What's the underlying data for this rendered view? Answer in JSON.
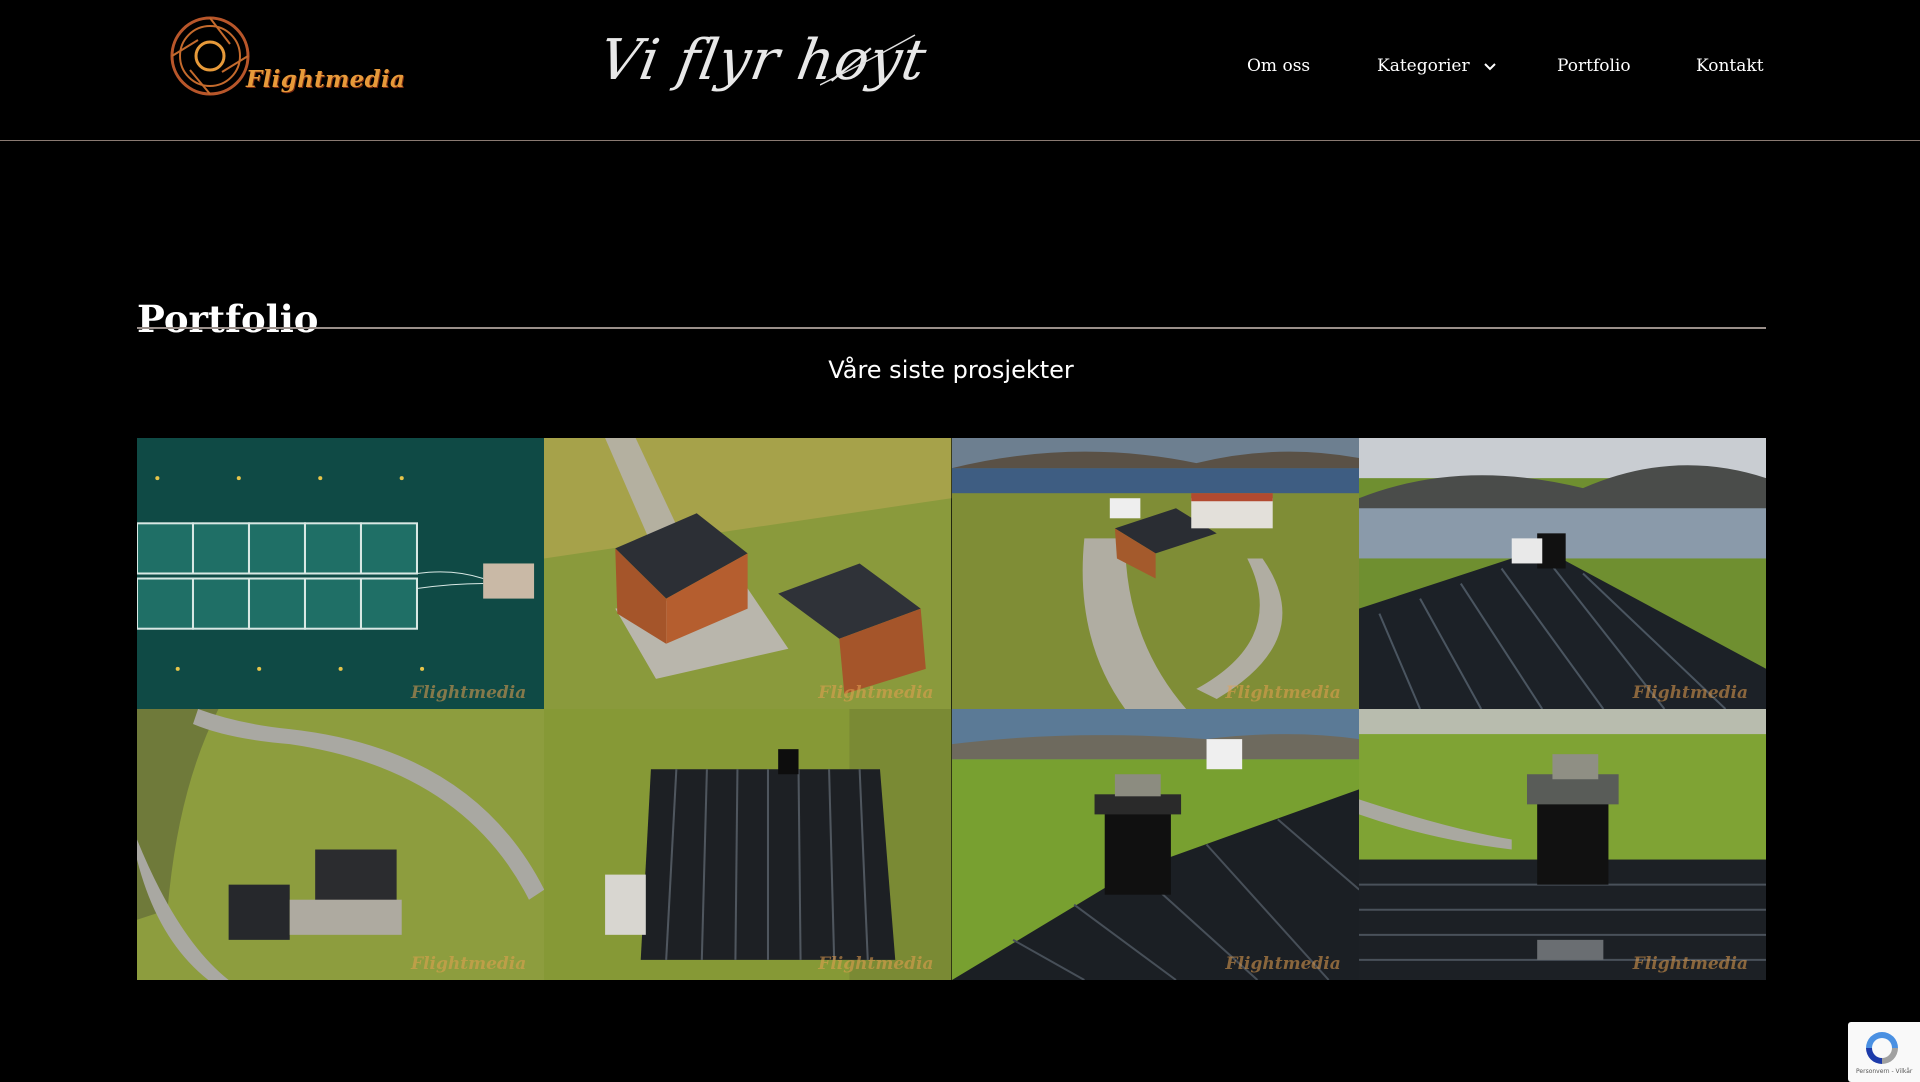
{
  "header": {
    "logo_text": "Flightmedia",
    "slogan": "Vi flyr høyt",
    "nav": [
      {
        "label": "Om oss",
        "has_dropdown": false
      },
      {
        "label": "Kategorier",
        "has_dropdown": true
      },
      {
        "label": "Portfolio",
        "has_dropdown": false
      },
      {
        "label": "Kontakt",
        "has_dropdown": false
      }
    ]
  },
  "main": {
    "title": "Portfolio",
    "subtitle": "Våre siste prosjekter",
    "watermark": "Flightmedia",
    "gallery": [
      {
        "subject": "fish-farm-aerial"
      },
      {
        "subject": "house-and-garage-aerial"
      },
      {
        "subject": "farm-by-fjord"
      },
      {
        "subject": "roof-with-fjord-view"
      },
      {
        "subject": "house-top-down"
      },
      {
        "subject": "black-roof-top-down"
      },
      {
        "subject": "chimney-and-fjord"
      },
      {
        "subject": "chimney-close-up"
      }
    ]
  },
  "recaptcha": {
    "text": "Personvern - Vilkår"
  },
  "colors": {
    "background": "#000000",
    "text": "#ffffff",
    "logo_accent": "#e79a3a",
    "rule": "#9a8f8a"
  }
}
